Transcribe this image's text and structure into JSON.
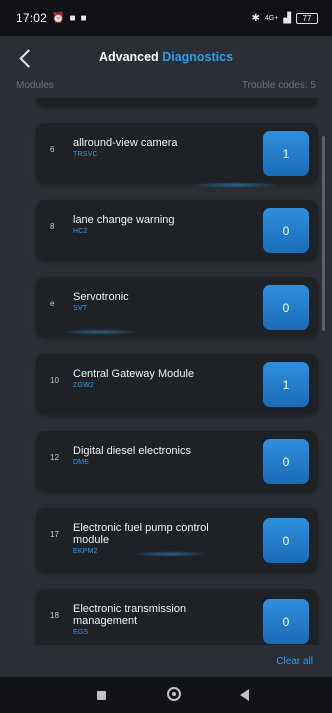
{
  "status_bar": {
    "time": "17:02",
    "network": "4G+",
    "battery": "77",
    "icons": [
      "alarm-icon",
      "video-icon",
      "video-icon",
      "bluetooth-icon",
      "signal-icon",
      "battery-icon"
    ]
  },
  "header": {
    "title_plain": "Advanced",
    "title_accent": "Diagnostics"
  },
  "columns": {
    "left": "Modules",
    "right": "Trouble codes: 5"
  },
  "modules": [
    {
      "index": "6",
      "name": "allround-view camera",
      "code": "TRSVC",
      "count": "1"
    },
    {
      "index": "8",
      "name": "lane change warning",
      "code": "HC2",
      "count": "0"
    },
    {
      "index": "e",
      "name": "Servotronic",
      "code": "SVT",
      "count": "0"
    },
    {
      "index": "10",
      "name": "Central Gateway Module",
      "code": "ZGW2",
      "count": "1"
    },
    {
      "index": "12",
      "name": "Digital diesel electronics",
      "code": "DME",
      "count": "0"
    },
    {
      "index": "17",
      "name": "Electronic fuel pump control module",
      "code": "EKPM2",
      "count": "0"
    },
    {
      "index": "18",
      "name": "Electronic transmission management",
      "code": "EGS",
      "count": "0"
    }
  ],
  "footer": {
    "clear_all": "Clear all"
  },
  "colors": {
    "accent": "#2f9be6",
    "background": "#2b2f35",
    "card": "#1e2125"
  }
}
